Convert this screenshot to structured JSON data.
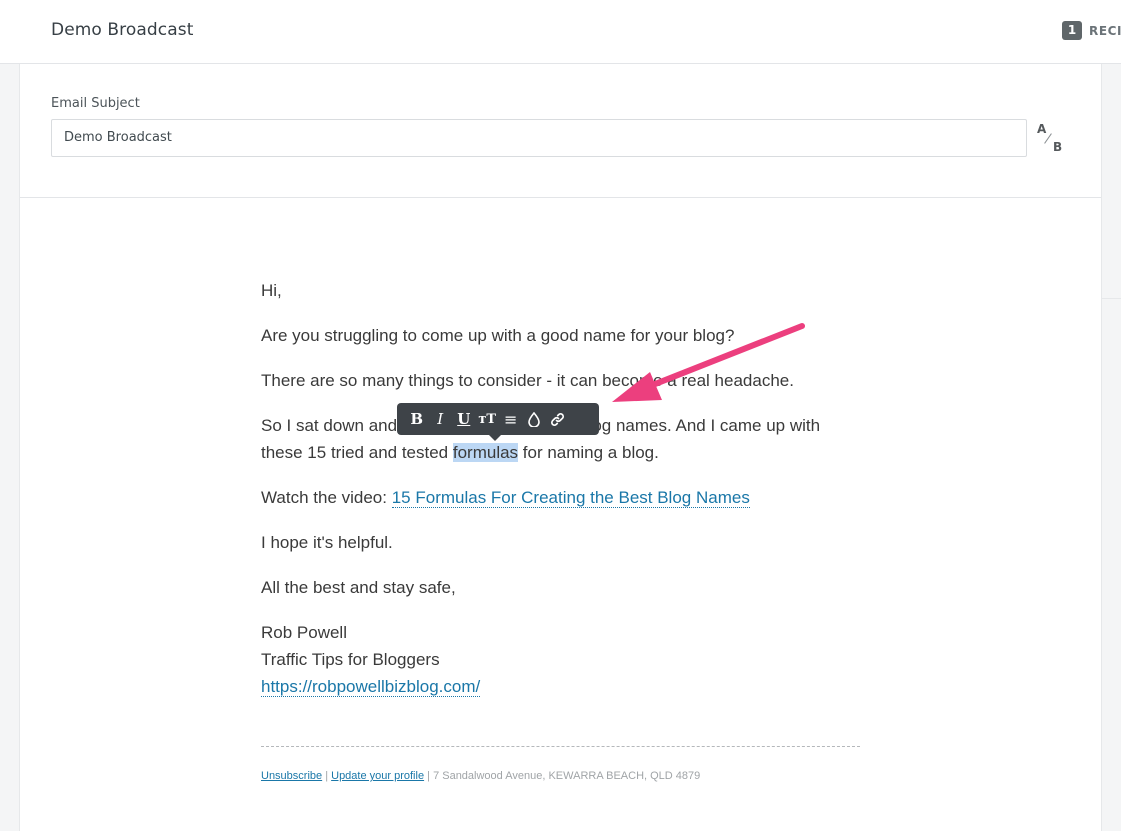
{
  "header": {
    "title": "Demo Broadcast",
    "recipients_count": "1",
    "recipients_label": "RECI"
  },
  "subject": {
    "label": "Email Subject",
    "value": "Demo Broadcast",
    "ab_a": "A",
    "ab_b": "B"
  },
  "email": {
    "greeting": "Hi,",
    "p1": "Are you struggling to come up with a good name for your blog?",
    "p2": "There are so many things to consider - it can become a real headache.",
    "p3_line1_pre": "So I sat down and",
    "p3_line1_post": "blog names. And I came up with",
    "p3_line2_pre": "these 15 tried and tested ",
    "p3_line2_highlight": "formulas",
    "p3_line2_post": " for naming a blog.",
    "video_prefix": "Watch the video: ",
    "video_link": "15 Formulas For Creating the Best Blog Names",
    "p5": "I hope it's helpful.",
    "p6": "All the best and stay safe,",
    "sig_name": "Rob Powell",
    "sig_tagline": "Traffic Tips for Bloggers",
    "sig_url": "https://robpowellbizblog.com/"
  },
  "toolbar": {
    "bold": "B",
    "italic": "I",
    "underline": "U",
    "font_size": "ᴛT",
    "align": "≡",
    "color": "💧",
    "link": "🔗",
    "icons": [
      "bold-icon",
      "italic-icon",
      "underline-icon",
      "text-size-icon",
      "align-icon",
      "color-drop-icon",
      "link-icon"
    ]
  },
  "footer": {
    "unsubscribe": "Unsubscribe",
    "sep1": " | ",
    "update_profile": "Update your profile",
    "sep2": " | ",
    "address": "7 Sandalwood Avenue, KEWARRA BEACH, QLD 4879"
  },
  "colors": {
    "link": "#1a77a8",
    "toolbar_bg": "#3e4348",
    "highlight": "#bcd7f4",
    "annotation_arrow": "#ec3f7e"
  }
}
